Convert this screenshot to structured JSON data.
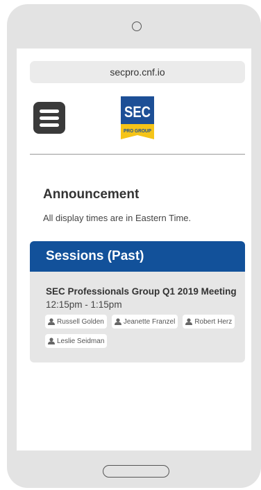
{
  "browser": {
    "url": "secpro.cnf.io"
  },
  "logo": {
    "line1": "SEC",
    "line2": "PRO GROUP",
    "bg": "#1d4f96",
    "ribbon": "#f5c418"
  },
  "announcement": {
    "title": "Announcement",
    "text": "All display times are in Eastern Time."
  },
  "sessions": {
    "header": "Sessions (Past)",
    "header_color": "#12519a",
    "items": [
      {
        "title": "SEC Professionals Group Q1 2019 Meeting",
        "time": "12:15pm - 1:15pm",
        "speakers": [
          "Russell Golden",
          "Jeanette Franzel",
          "Robert Herz",
          "Leslie Seidman"
        ]
      }
    ]
  },
  "icons": {
    "menu": "hamburger-menu-icon",
    "speaker": "person-icon"
  }
}
